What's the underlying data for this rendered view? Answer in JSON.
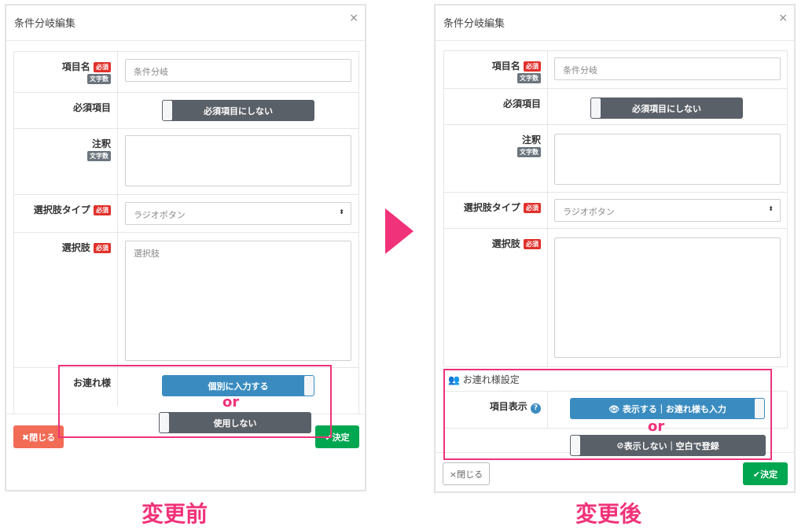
{
  "before": {
    "title": "条件分岐編集",
    "close_icon": "×",
    "rows": {
      "name": {
        "label": "項目名",
        "required": "必須",
        "count": "文字数",
        "placeholder": "条件分岐"
      },
      "required_item": {
        "label": "必須項目",
        "toggle": "必須項目にしない"
      },
      "note": {
        "label": "注釈",
        "count": "文字数"
      },
      "choice_type": {
        "label": "選択肢タイプ",
        "required": "必須",
        "value": "ラジオボタン"
      },
      "choices": {
        "label": "選択肢",
        "required": "必須",
        "placeholder": "選択肢"
      },
      "companion": {
        "label": "お連れ様",
        "toggle_on": "個別に入力する",
        "or": "or",
        "toggle_off": "使用しない"
      }
    },
    "close_button": "✖閉じる",
    "submit_button": "✔決定",
    "caption": "変更前"
  },
  "after": {
    "title": "条件分岐編集",
    "close_icon": "×",
    "rows": {
      "name": {
        "label": "項目名",
        "required": "必須",
        "count": "文字数",
        "placeholder": "条件分岐"
      },
      "required_item": {
        "label": "必須項目",
        "toggle": "必須項目にしない"
      },
      "note": {
        "label": "注釈",
        "count": "文字数"
      },
      "choice_type": {
        "label": "選択肢タイプ",
        "required": "必須",
        "value": "ラジオボタン"
      },
      "choices": {
        "label": "選択肢",
        "required": "必須"
      }
    },
    "companion_section": {
      "title": "お連れ様設定",
      "label": "項目表示",
      "help": "?",
      "toggle_on": "👁 表示する｜お連れ様も入力",
      "or": "or",
      "toggle_off": "表示しない｜空白で登録"
    },
    "close_button": "×閉じる",
    "submit_button": "✔決定",
    "caption": "変更後"
  },
  "colors": {
    "accent": "#f0327a",
    "required": "#e0302b",
    "toggle_on": "#3a8cc0",
    "toggle_off": "#5a6068",
    "submit": "#00a650",
    "close_before": "#f26b55"
  }
}
